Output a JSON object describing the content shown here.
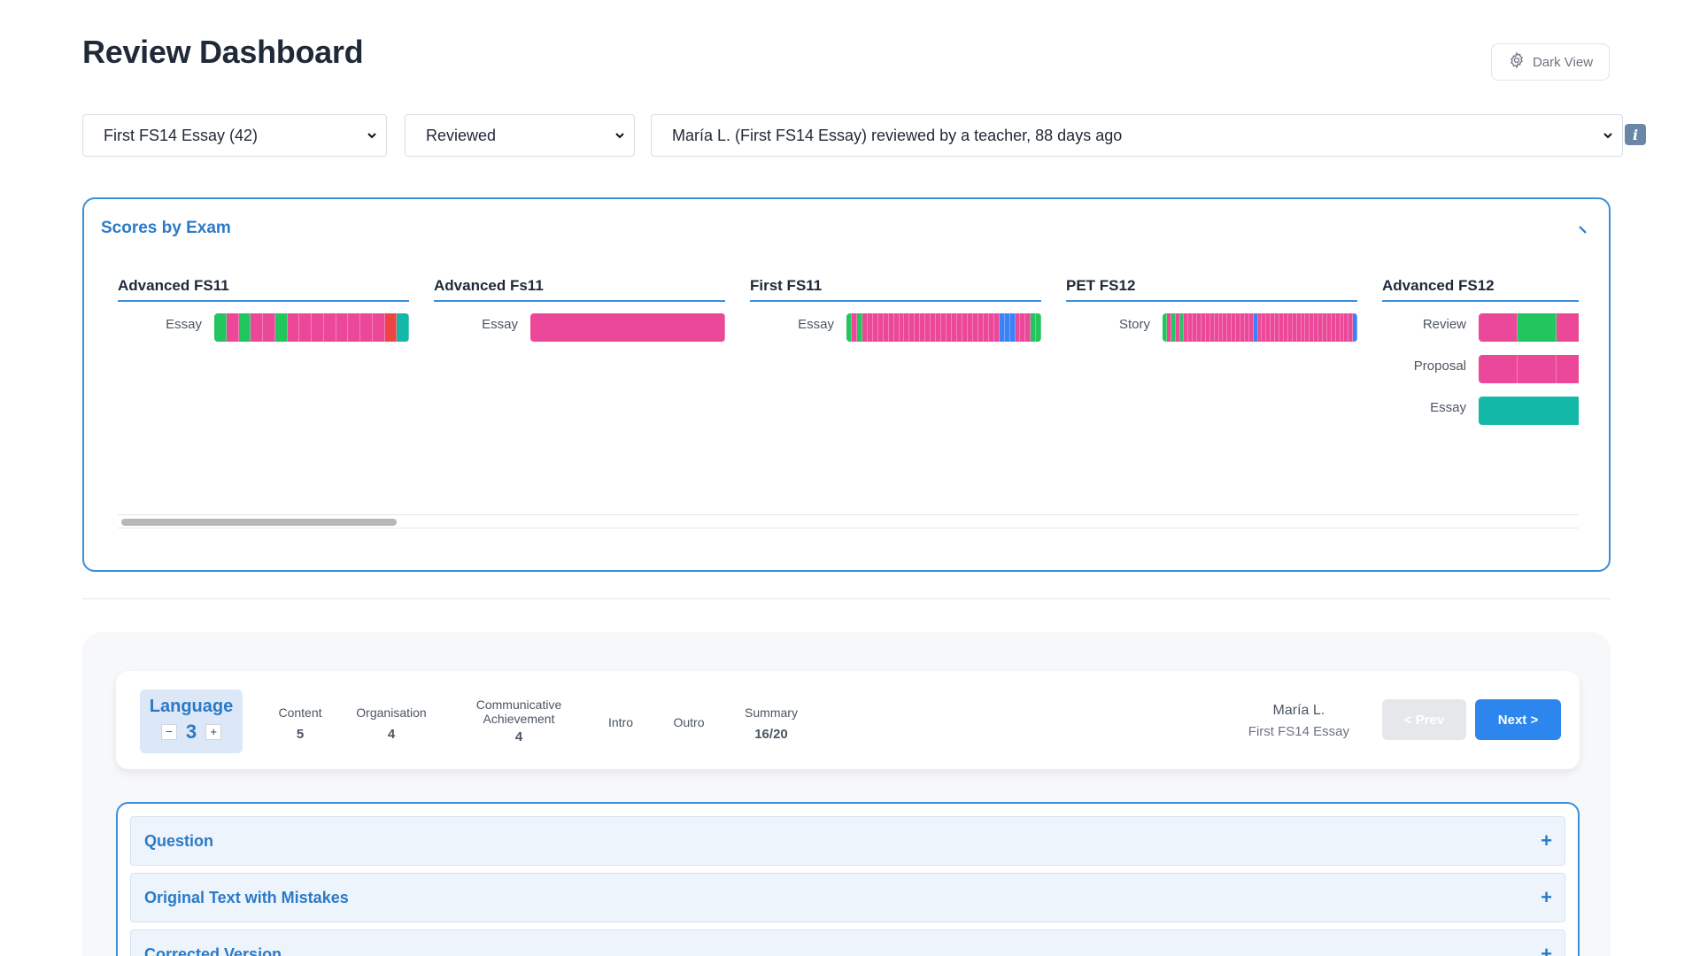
{
  "page": {
    "title": "Review Dashboard"
  },
  "theme_toggle": {
    "label": "Dark View",
    "icon": "gear-icon"
  },
  "filters": {
    "exam_select": "First FS14 Essay (42)",
    "status_select": "Reviewed",
    "student_select": "María L. (First FS14 Essay) reviewed by a teacher, 88 days ago",
    "info_icon": "i"
  },
  "colors": {
    "green": "#22c55e",
    "pink": "#ec4899",
    "red": "#ef4444",
    "teal": "#14b8a6",
    "blue": "#3b82f6",
    "accent": "#2b7ac6"
  },
  "scores_panel": {
    "title": "Scores by Exam",
    "exams": [
      {
        "name": "Advanced FS11",
        "rows": [
          {
            "label": "Essay",
            "segments": [
              "green",
              "pink",
              "green",
              "pink",
              "pink",
              "green",
              "pink",
              "pink",
              "pink",
              "pink",
              "pink",
              "pink",
              "pink",
              "pink",
              "red",
              "teal"
            ]
          }
        ]
      },
      {
        "name": "Advanced Fs11",
        "rows": [
          {
            "label": "Essay",
            "segments": [
              "pink"
            ]
          }
        ]
      },
      {
        "name": "First FS11",
        "rows": [
          {
            "label": "Essay",
            "segments": [
              "green",
              "pink",
              "green",
              "pink",
              "pink",
              "pink",
              "pink",
              "pink",
              "pink",
              "pink",
              "pink",
              "pink",
              "pink",
              "pink",
              "pink",
              "pink",
              "pink",
              "pink",
              "pink",
              "pink",
              "pink",
              "pink",
              "pink",
              "pink",
              "pink",
              "pink",
              "pink",
              "pink",
              "pink",
              "blue",
              "blue",
              "blue",
              "pink",
              "pink",
              "pink",
              "green",
              "green"
            ]
          }
        ]
      },
      {
        "name": "PET FS12",
        "rows": [
          {
            "label": "Story",
            "segments": [
              "green",
              "pink",
              "green",
              "pink",
              "green",
              "pink",
              "pink",
              "pink",
              "pink",
              "pink",
              "pink",
              "pink",
              "pink",
              "pink",
              "pink",
              "pink",
              "pink",
              "pink",
              "pink",
              "pink",
              "pink",
              "blue",
              "pink",
              "pink",
              "pink",
              "pink",
              "pink",
              "pink",
              "pink",
              "pink",
              "pink",
              "pink",
              "pink",
              "pink",
              "pink",
              "pink",
              "pink",
              "pink",
              "pink",
              "pink",
              "pink",
              "pink",
              "pink",
              "pink",
              "blue"
            ]
          }
        ]
      },
      {
        "name": "Advanced FS12",
        "rows": [
          {
            "label": "Review",
            "segments": [
              "pink",
              "green",
              "pink",
              "pink",
              "pink"
            ]
          },
          {
            "label": "Proposal",
            "segments": [
              "pink",
              "pink",
              "pink",
              "pink",
              "pink"
            ]
          },
          {
            "label": "Essay",
            "segments": [
              "teal"
            ]
          }
        ]
      }
    ]
  },
  "score_card": {
    "active": {
      "label": "Language",
      "value": "3",
      "minus": "−",
      "plus": "+"
    },
    "criteria": [
      {
        "label": "Content",
        "value": "5"
      },
      {
        "label": "Organisation",
        "value": "4"
      },
      {
        "label": "Communicative Achievement",
        "value": "4"
      },
      {
        "label": "Intro",
        "value": ""
      },
      {
        "label": "Outro",
        "value": ""
      },
      {
        "label": "Summary",
        "value": "16/20"
      }
    ],
    "student_name": "María L.",
    "student_exam": "First FS14 Essay",
    "prev_label": "< Prev",
    "next_label": "Next >"
  },
  "sections": [
    {
      "title": "Question",
      "icon": "+"
    },
    {
      "title": "Original Text with Mistakes",
      "icon": "+"
    },
    {
      "title": "Corrected Version",
      "icon": "+"
    }
  ]
}
